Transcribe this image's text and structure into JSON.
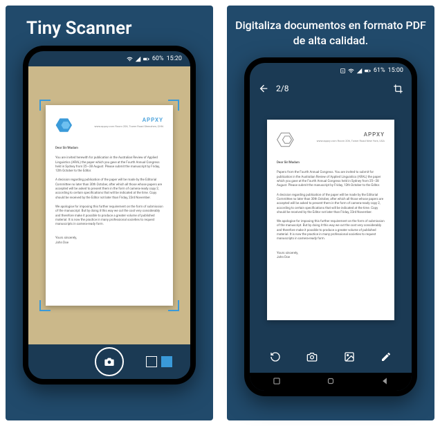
{
  "panel1": {
    "title": "Tiny Scanner",
    "status": {
      "battery": "60%",
      "time": "15:20"
    },
    "document": {
      "company": "APPXY",
      "addr": "www.appxy.com\nRoom 206, Tower Road\nShenzhen, CHN",
      "salutation": "Dear Sir/Madam",
      "para1": "You are invited herewith for publication in the Australian Review of Applied Linguistics (ARAL) the paper which you gave at the Fourth Annual Congress held in Sydney from 25—28 August. Please submit the manuscript by Friday, 12th October to the Editor.",
      "para2": "A decision regarding publication of the paper will be made by the Editorial Committee no later than 30th October, after which all those whose papers are accepted will be asked to present them in the form of camera-ready copy 2, according to certain specifications that will be indicated at the time. Copy should be received by the Editor not later than Friday, 23rd November.",
      "para3": "We apologise for imposing this further requirement on the form of submission of the manuscript. But by doing it this way we cut the cost very considerably and therefore make it possible to produce a greater volume of published material. It is now the practice in many professional societies to request manuscripts in camera-ready form.",
      "signoff": "Yours sincerely,",
      "signer": "John Doe"
    }
  },
  "panel2": {
    "subtitle": "Digitaliza documentos en formato PDF de alta calidad.",
    "status": {
      "battery": "61%",
      "time": "15:00"
    },
    "page_indicator": "2/8",
    "document": {
      "company": "APPXY",
      "addr": "www.appxy.com\nRoom 206, Tower Road\nNew York, USA",
      "salutation": "Dear Sir/Madam",
      "para1": "Papers from the Fourth Annual Congress. You are invited to submit for publication in the Australian Review of Applied Linguistics (ARAL) the paper which you gave at the Fourth Annual Congress held in Sydney from 25—28 August. Please submit the manuscript by Friday, 12th October to the Editor.",
      "para2": "A decision regarding publication of the paper will be made by the Editorial Committee no later than 30th October, after which all those whose papers are accepted will be asked to present them in the form of camera-ready copy 2, according to certain specifications that will be indicated at the time. Copy should be received by the Editor not later than Friday, 23rd November.",
      "para3": "We apologise for imposing this further requirement on the form of submission of the manuscript. But by doing it this way we cut the cost very considerably and therefore make it possible to produce a greater volume of published material. It is now the practice in many professional societies to request manuscripts in camera-ready form.",
      "signoff": "Yours sincerely,",
      "signer": "John Doe"
    }
  }
}
